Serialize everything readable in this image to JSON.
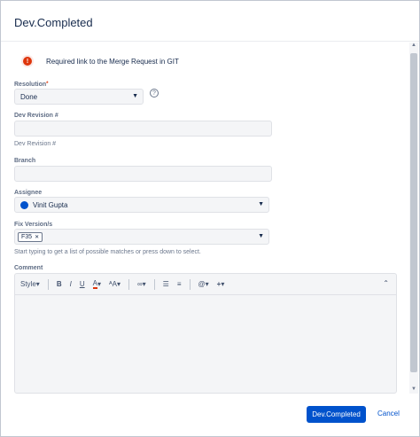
{
  "dialog": {
    "title": "Dev.Completed"
  },
  "warning": {
    "icon": "error-icon",
    "text": "Required link to the Merge Request in GIT"
  },
  "resolution": {
    "label": "Resolution",
    "required_marker": "*",
    "value": "Done",
    "help_glyph": "?"
  },
  "dev_revision": {
    "label": "Dev Revision #",
    "value": "",
    "hint": "Dev Revision #"
  },
  "branch": {
    "label": "Branch",
    "value": ""
  },
  "assignee": {
    "label": "Assignee",
    "value": "Vinit Gupta"
  },
  "fix_versions": {
    "label": "Fix Version/s",
    "tags": [
      "F35"
    ],
    "hint": "Start typing to get a list of possible matches or press down to select."
  },
  "comment": {
    "label": "Comment",
    "toolbar": {
      "style": "Style",
      "bold": "B",
      "italic": "I",
      "underline": "U",
      "text_color": "A",
      "text_size": "ᴬA",
      "link": "🔗",
      "bullet_list": "☰",
      "numbered_list": "≡",
      "mention": "@",
      "insert": "+",
      "collapse": "⌃"
    },
    "value": ""
  },
  "footer": {
    "primary_label": "Dev.Completed",
    "cancel_label": "Cancel"
  },
  "colors": {
    "primary": "#0052cc",
    "error": "#de350b",
    "field_bg": "#f4f5f7"
  }
}
